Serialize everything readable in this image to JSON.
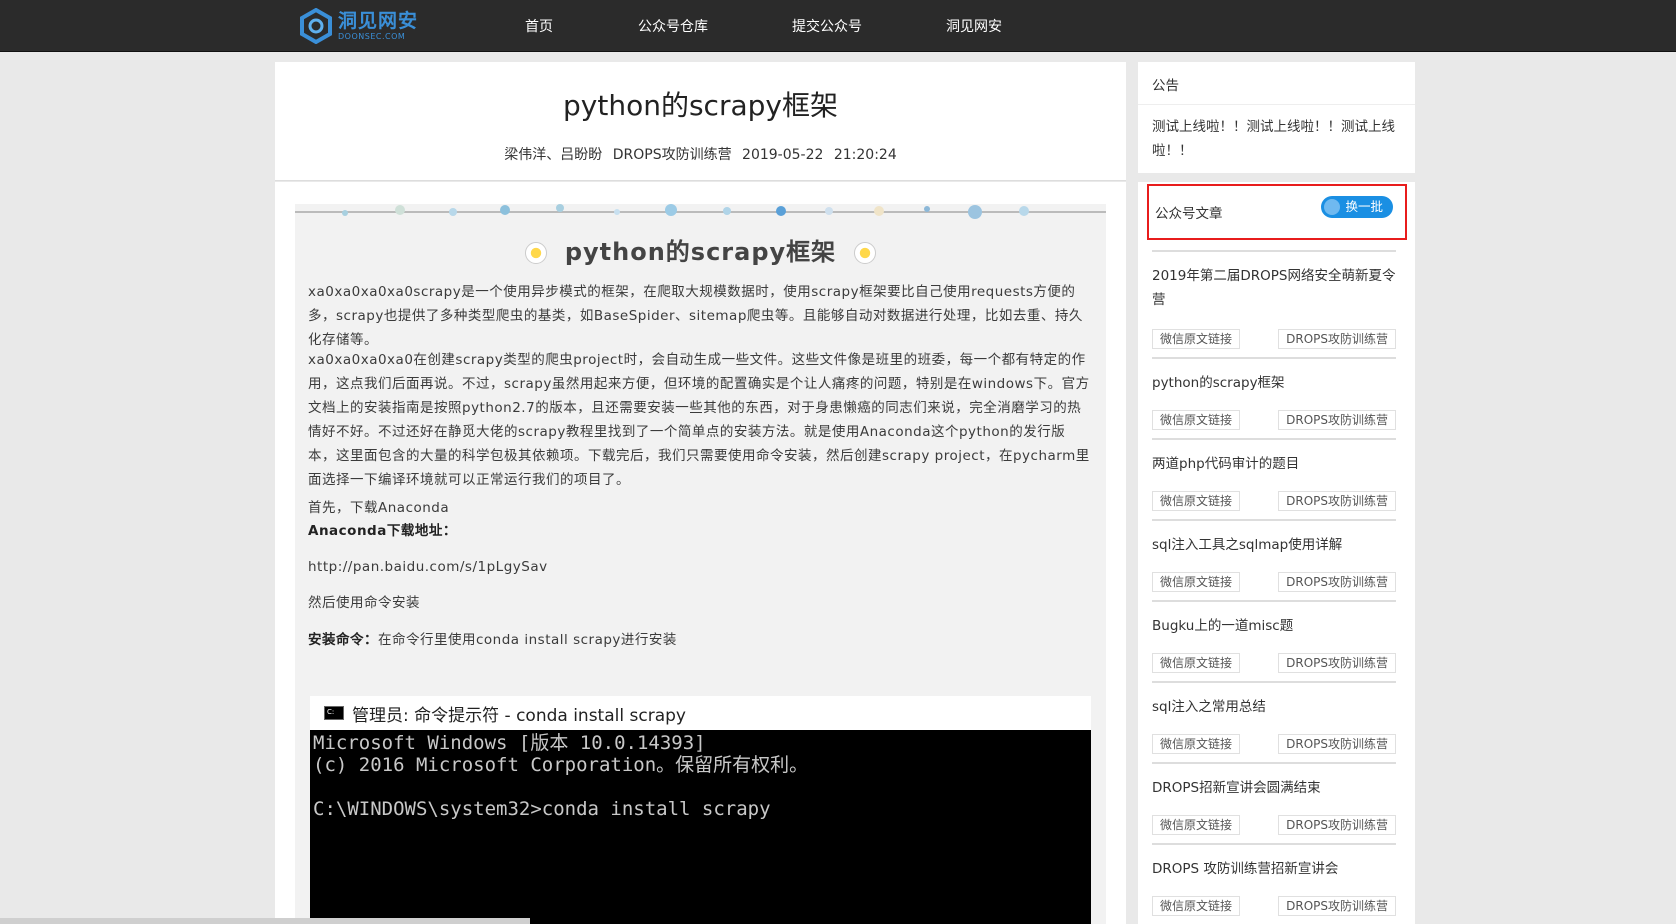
{
  "navbar": {
    "logo_cn": "洞见网安",
    "logo_en": "DOONSEC.COM",
    "items": [
      "首页",
      "公众号仓库",
      "提交公众号",
      "洞见网安"
    ]
  },
  "article": {
    "title": "python的scrapy框架",
    "authors": "梁伟洋、吕盼盼",
    "account": "DROPS攻防训练营",
    "date": "2019-05-22 21:20:24",
    "inner_title": "python的scrapy框架",
    "p1": "xa0xa0xa0xa0scrapy是一个使用异步模式的框架，在爬取大规模数据时，使用scrapy框架要比自己使用requests方便的多，scrapy也提供了多种类型爬虫的基类，如BaseSpider、sitemap爬虫等。且能够自动对数据进行处理，比如去重、持久化存储等。",
    "p2": "xa0xa0xa0xa0在创建scrapy类型的爬虫project时，会自动生成一些文件。这些文件像是班里的班委，每一个都有特定的作用，这点我们后面再说。不过，scrapy虽然用起来方便，但环境的配置确实是个让人痛疼的问题，特别是在windows下。官方文档上的安装指南是按照python2.7的版本，且还需要安装一些其他的东西，对于身患懒癌的同志们来说，完全消磨学习的热情好不好。不过还好在静觅大佬的scrapy教程里找到了一个简单点的安装方法。就是使用Anaconda这个python的发行版本，这里面包含的大量的科学包极其依赖项。下载完后，我们只需要使用命令安装，然后创建scrapy project，在pycharm里面选择一下编译环境就可以正常运行我们的项目了。",
    "p3": "首先，下载Anaconda",
    "p4": "Anaconda下载地址：",
    "p5": "http://pan.baidu.com/s/1pLgySav",
    "p6": "然后使用命令安装",
    "p7_bold": "安装命令：",
    "p7_rest": "在命令行里使用conda install scrapy进行安装",
    "cmd_title": "管理员: 命令提示符 - conda  install scrapy",
    "cmd_lines": "Microsoft Windows [版本 10.0.14393]\n(c) 2016 Microsoft Corporation。保留所有权利。\n\nC:\\WINDOWS\\system32>conda install scrapy"
  },
  "sidebar": {
    "notice_title": "公告",
    "notice_text": "测试上线啦！！测试上线啦！！测试上线啦！！",
    "articles_title": "公众号文章",
    "swap_label": "换一批",
    "tag_link": "微信原文链接",
    "tag_account": "DROPS攻防训练营",
    "items": [
      "2019年第二届DROPS网络安全萌新夏令营",
      "python的scrapy框架",
      "两道php代码审计的题目",
      "sql注入工具之sqlmap使用详解",
      "Bugku上的一道misc题",
      "sql注入之常用总结",
      "DROPS招新宣讲会圆满结束",
      "DROPS 攻防训练营招新宣讲会"
    ]
  },
  "colors": {
    "navbar_bg": "#2b2b2b",
    "brand_blue": "#1a8fe3",
    "highlight_red": "#e81c1c"
  }
}
